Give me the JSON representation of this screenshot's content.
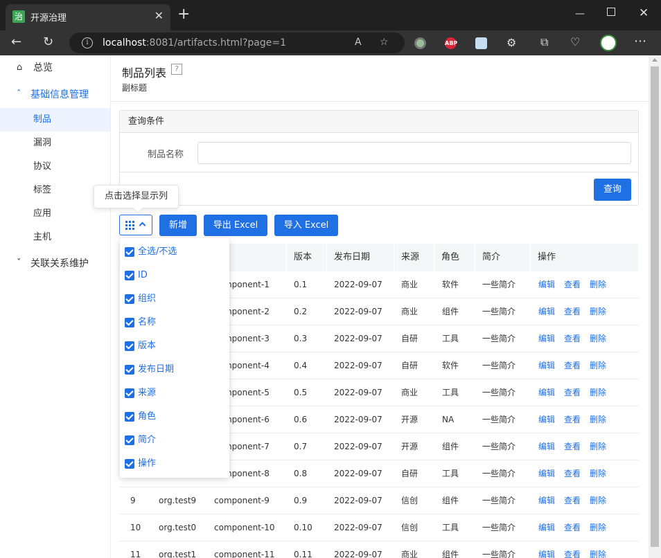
{
  "browser": {
    "tab_title": "开源治理",
    "tab_icon_text": "治",
    "url_host": "localhost",
    "url_rest": ":8081/artifacts.html?page=1",
    "ext_abp": "ABP"
  },
  "sidebar": {
    "overview": "总览",
    "group_basic": "基础信息管理",
    "items": [
      "制品",
      "漏洞",
      "协议",
      "标签",
      "应用",
      "主机"
    ],
    "group_relation": "关联关系维护"
  },
  "header": {
    "title": "制品列表",
    "help": "?",
    "subtitle": "副标题"
  },
  "query": {
    "panel_title": "查询条件",
    "field_label": "制品名称",
    "field_value": "",
    "submit": "查询"
  },
  "toolbar": {
    "tooltip": "点击选择显示列",
    "add": "新增",
    "export": "导出 Excel",
    "import": "导入 Excel"
  },
  "column_picker": {
    "options": [
      "全选/不选",
      "ID",
      "组织",
      "名称",
      "版本",
      "发布日期",
      "来源",
      "角色",
      "简介",
      "操作"
    ]
  },
  "table": {
    "visible_headers": {
      "name_partial": "称",
      "version": "版本",
      "date": "发布日期",
      "source": "来源",
      "role": "角色",
      "intro": "简介",
      "ops": "操作"
    },
    "row_actions": [
      "编辑",
      "查看",
      "删除"
    ],
    "rows": [
      {
        "id": "",
        "org": "",
        "name": "component-1",
        "version": "0.1",
        "date": "2022-09-07",
        "source": "商业",
        "role": "软件",
        "intro": "一些简介"
      },
      {
        "id": "",
        "org": "",
        "name": "component-2",
        "version": "0.2",
        "date": "2022-09-07",
        "source": "商业",
        "role": "组件",
        "intro": "一些简介"
      },
      {
        "id": "",
        "org": "",
        "name": "component-3",
        "version": "0.3",
        "date": "2022-09-07",
        "source": "自研",
        "role": "工具",
        "intro": "一些简介"
      },
      {
        "id": "",
        "org": "",
        "name": "component-4",
        "version": "0.4",
        "date": "2022-09-07",
        "source": "自研",
        "role": "软件",
        "intro": "一些简介"
      },
      {
        "id": "",
        "org": "",
        "name": "component-5",
        "version": "0.5",
        "date": "2022-09-07",
        "source": "商业",
        "role": "工具",
        "intro": "一些简介"
      },
      {
        "id": "",
        "org": "",
        "name": "component-6",
        "version": "0.6",
        "date": "2022-09-07",
        "source": "开源",
        "role": "NA",
        "intro": "一些简介"
      },
      {
        "id": "",
        "org": "",
        "name": "component-7",
        "version": "0.7",
        "date": "2022-09-07",
        "source": "开源",
        "role": "组件",
        "intro": "一些简介"
      },
      {
        "id": "",
        "org": "",
        "name": "component-8",
        "version": "0.8",
        "date": "2022-09-07",
        "source": "自研",
        "role": "工具",
        "intro": "一些简介"
      },
      {
        "id": "9",
        "org": "org.test9",
        "name": "component-9",
        "version": "0.9",
        "date": "2022-09-07",
        "source": "信创",
        "role": "组件",
        "intro": "一些简介"
      },
      {
        "id": "10",
        "org": "org.test0",
        "name": "component-10",
        "version": "0.10",
        "date": "2022-09-07",
        "source": "信创",
        "role": "工具",
        "intro": "一些简介"
      },
      {
        "id": "11",
        "org": "org.test1",
        "name": "component-11",
        "version": "0.11",
        "date": "2022-09-07",
        "source": "商业",
        "role": "组件",
        "intro": "一些简介"
      }
    ]
  }
}
